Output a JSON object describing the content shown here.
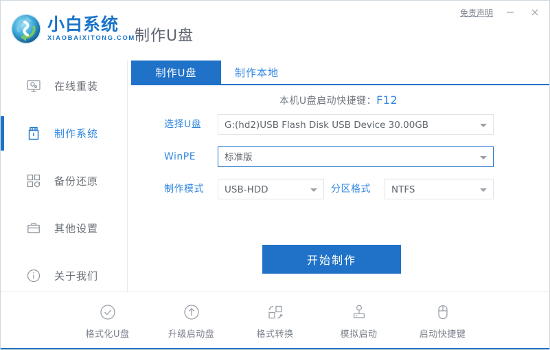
{
  "window": {
    "title": "制作U盘",
    "disclaimer": "免责声明",
    "minimize": "—",
    "close": "×"
  },
  "brand": {
    "name_cn": "小白系统",
    "name_en": "XIAOBAIXITONG.COM",
    "logo_icon": "recycle-logo-icon"
  },
  "sidebar": {
    "items": [
      {
        "label": "在线重装",
        "icon": "monitor-icon",
        "active": false
      },
      {
        "label": "制作系统",
        "icon": "usb-drive-icon",
        "active": true
      },
      {
        "label": "备份还原",
        "icon": "backup-squares-icon",
        "active": false
      },
      {
        "label": "其他设置",
        "icon": "toolbox-icon",
        "active": false
      },
      {
        "label": "关于我们",
        "icon": "info-circle-icon",
        "active": false
      }
    ]
  },
  "main": {
    "tabs": [
      {
        "label": "制作U盘",
        "active": true
      },
      {
        "label": "制作本地",
        "active": false
      }
    ],
    "hotkey_text": "本机U盘启动快捷键：",
    "hotkey_value": "F12",
    "fields": {
      "usb": {
        "label": "选择U盘",
        "value": "G:(hd2)USB Flash Disk USB Device 30.00GB",
        "focused": false
      },
      "winpe": {
        "label": "WinPE",
        "value": "标准版",
        "focused": true
      },
      "mode": {
        "label": "制作模式",
        "value": "USB-HDD",
        "focused": false
      },
      "partition": {
        "label": "分区格式",
        "value": "NTFS",
        "focused": false
      }
    },
    "start_button": "开始制作"
  },
  "bottom_tools": [
    {
      "label": "格式化U盘",
      "icon": "check-circle-icon"
    },
    {
      "label": "升级启动盘",
      "icon": "arrow-up-circle-icon"
    },
    {
      "label": "格式转换",
      "icon": "convert-shapes-icon"
    },
    {
      "label": "模拟启动",
      "icon": "joystick-icon"
    },
    {
      "label": "启动快捷键",
      "icon": "mouse-icon"
    }
  ],
  "colors": {
    "accent": "#2072c8",
    "accent_light": "#2f86e0",
    "text_muted": "#7b828c",
    "border": "#e0e4e8"
  }
}
